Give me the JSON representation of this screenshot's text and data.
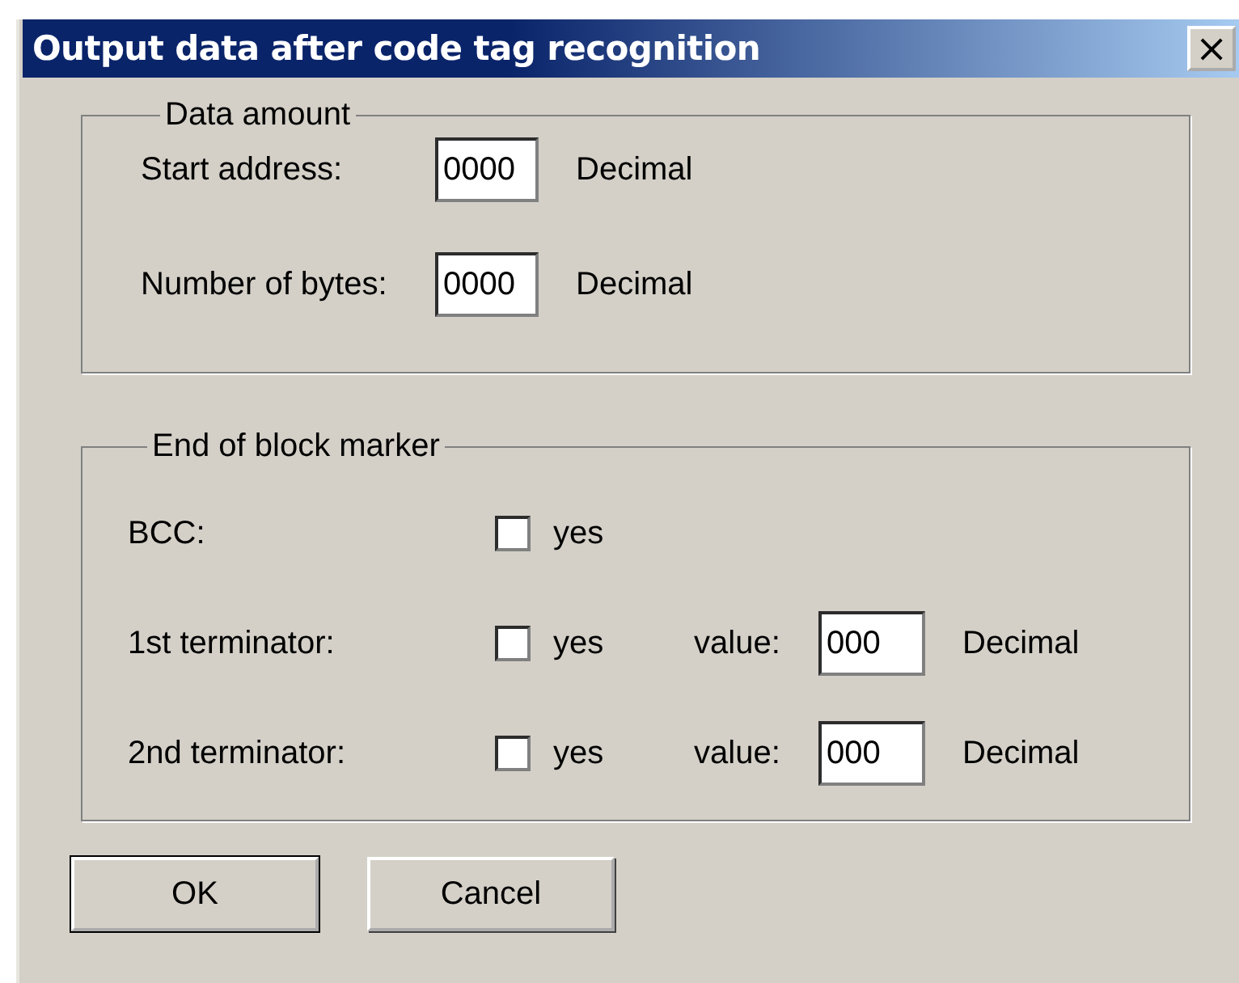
{
  "window": {
    "title": "Output data after code tag recognition",
    "close": "×"
  },
  "data_amount": {
    "title": "Data amount",
    "rows": [
      {
        "label": "Start address:",
        "value": "0000",
        "unit": "Decimal"
      },
      {
        "label": "Number of bytes:",
        "value": "0000",
        "unit": "Decimal"
      }
    ]
  },
  "end_marker": {
    "title": "End of block marker",
    "rows": [
      {
        "kind": "check",
        "label": "BCC:",
        "checked": false,
        "check_label": "yes"
      },
      {
        "kind": "check-value",
        "label": "1st terminator:",
        "checked": false,
        "check_label": "yes",
        "value_label": "value:",
        "value": "000",
        "unit": "Decimal"
      },
      {
        "kind": "check-value",
        "label": "2nd terminator:",
        "checked": false,
        "check_label": "yes",
        "value_label": "value:",
        "value": "000",
        "unit": "Decimal"
      }
    ]
  },
  "buttons": [
    "OK",
    "Cancel"
  ]
}
